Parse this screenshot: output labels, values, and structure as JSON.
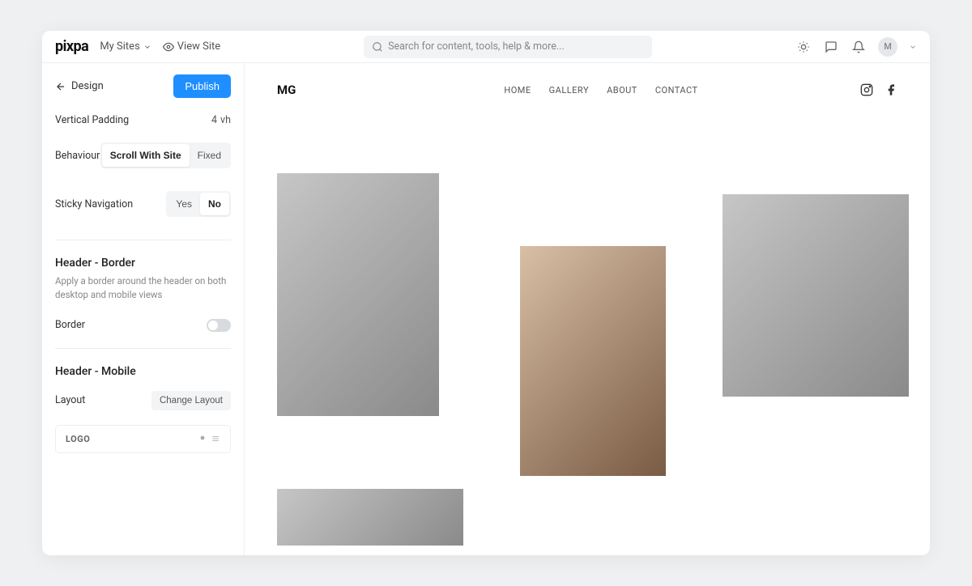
{
  "topbar": {
    "logo": "pixpa",
    "mySites": "My Sites",
    "viewSite": "View Site",
    "searchPlaceholder": "Search for content, tools, help & more...",
    "avatarInitial": "M"
  },
  "sidebar": {
    "back": "Design",
    "publish": "Publish",
    "verticalPadding": {
      "label": "Vertical Padding",
      "value": "4",
      "unit": "vh"
    },
    "behaviour": {
      "label": "Behaviour",
      "options": [
        "Scroll With Site",
        "Fixed"
      ],
      "active": "Scroll With Site"
    },
    "stickyNav": {
      "label": "Sticky Navigation",
      "options": [
        "Yes",
        "No"
      ],
      "active": "No"
    },
    "headerBorder": {
      "title": "Header - Border",
      "desc": "Apply a border around the header on both desktop and mobile views",
      "borderLabel": "Border",
      "borderValue": false
    },
    "headerMobile": {
      "title": "Header - Mobile",
      "layoutLabel": "Layout",
      "changeLayout": "Change Layout",
      "logoPlaceholder": "LOGO"
    }
  },
  "site": {
    "logo": "MG",
    "nav": [
      "HOME",
      "GALLERY",
      "ABOUT",
      "CONTACT"
    ]
  }
}
